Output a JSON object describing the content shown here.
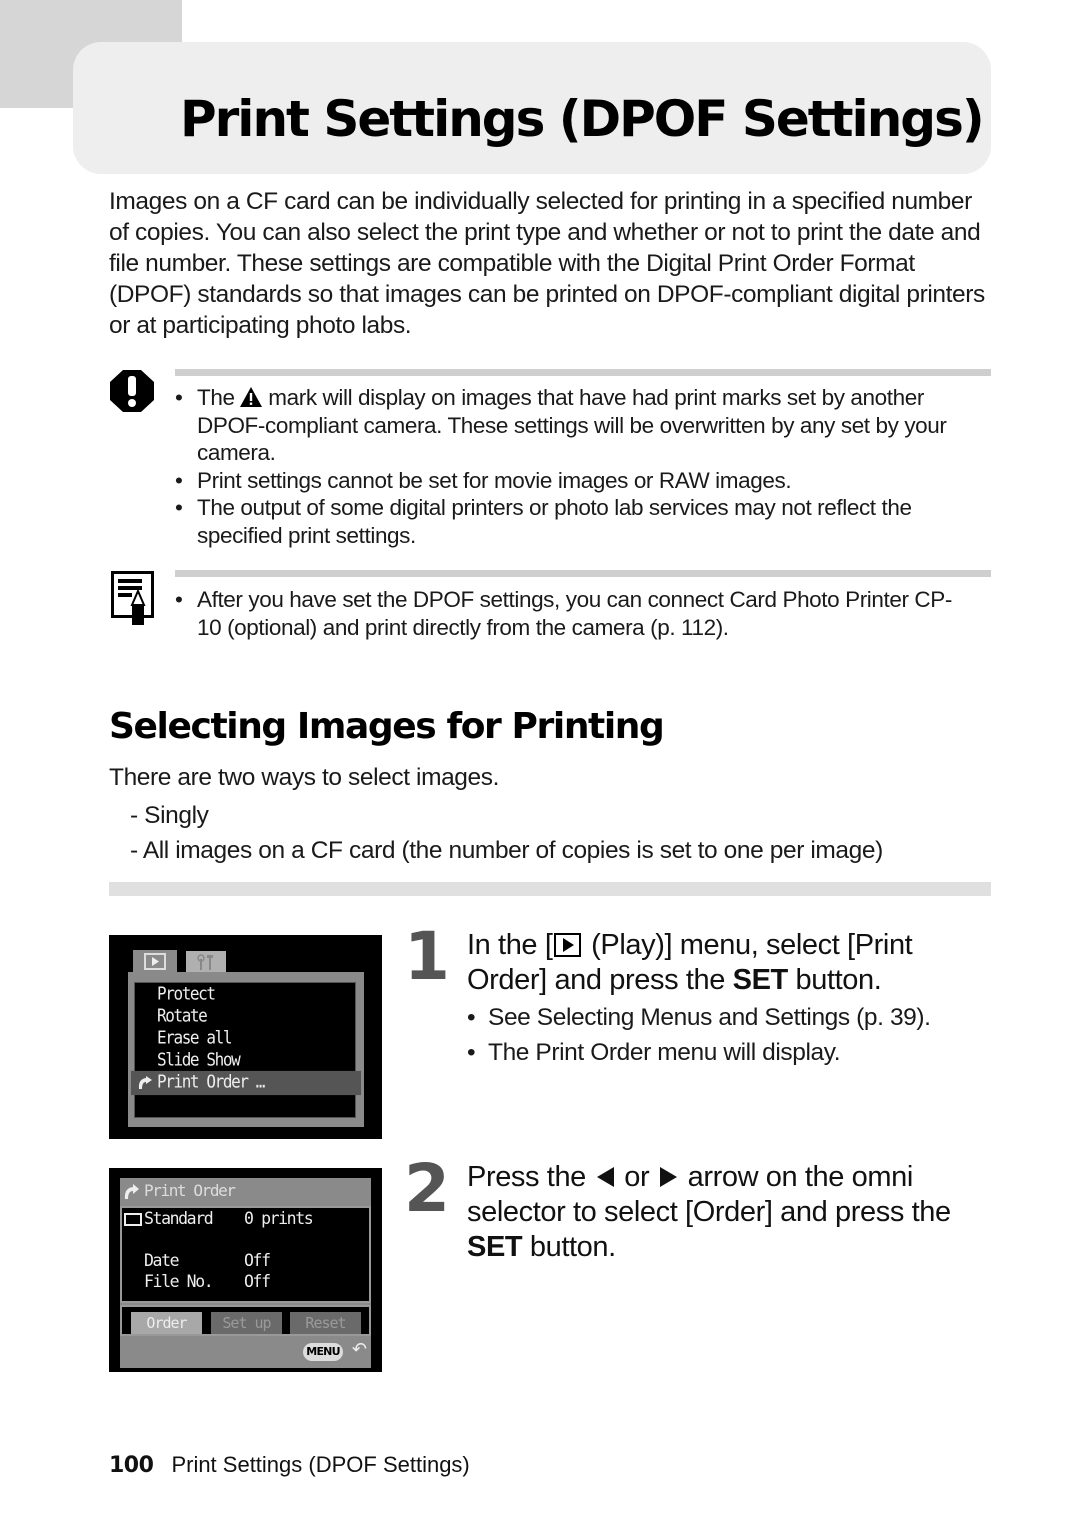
{
  "page": {
    "title": "Print Settings (DPOF Settings)",
    "intro": "Images on a CF card can be individually selected for printing in a specified number of copies. You can also select the print type and whether or not to print the date and file number. These settings are compatible with the Digital Print Order Format (DPOF) standards so that images can be printed on DPOF-compliant digital printers or at participating photo labs."
  },
  "caution": {
    "icon": "caution-icon",
    "items": [
      {
        "before_icon": "The",
        "icon": "warning-triangle-icon",
        "after_icon": "mark will display on images that have had print marks set by another DPOF-compliant camera. These settings will be overwritten by any set by your camera."
      },
      {
        "text": "Print settings cannot be set for movie images or RAW images."
      },
      {
        "text": "The output of some digital printers or photo lab services may not reflect the specified print settings."
      }
    ]
  },
  "note": {
    "icon": "note-icon",
    "items": [
      {
        "text": "After you have set the DPOF settings, you can connect Card Photo Printer CP-10 (optional) and print directly from the camera (p. 112)."
      }
    ]
  },
  "section": {
    "title": "Selecting Images for Printing",
    "lead": "There are two ways to select images.",
    "ways": [
      "- Singly",
      "- All images on a CF card (the number of copies is set to one per image)"
    ]
  },
  "screen1": {
    "tabs": [
      "play-tab",
      "setup-tab"
    ],
    "menu_items": [
      "Protect",
      "Rotate",
      "Erase all",
      "Slide Show",
      "Print Order …"
    ],
    "selected_index": 4
  },
  "screen2": {
    "header": "Print Order",
    "type_label": "Standard",
    "type_value": "0 prints",
    "date_label": "Date",
    "date_value": "Off",
    "fileno_label": "File No.",
    "fileno_value": "Off",
    "buttons": [
      "Order",
      "Set up",
      "Reset"
    ],
    "selected_button": "Order",
    "menu_label": "MENU",
    "back_glyph": "↶"
  },
  "steps": [
    {
      "number": "1",
      "text_a": "In the [",
      "text_b": " (Play)] menu, select [Print Order] and press the ",
      "key": "SET",
      "text_c": " button.",
      "bullets": [
        "See Selecting Menus and Settings (p. 39).",
        "The Print Order menu will display."
      ]
    },
    {
      "number": "2",
      "text_a": "Press the",
      "text_b": "or",
      "text_c": "arrow on the omni selector to select [Order] and press the",
      "key": "SET",
      "text_d": "button."
    }
  ],
  "footer": {
    "page_number": "100",
    "title": "Print Settings (DPOF Settings)"
  }
}
